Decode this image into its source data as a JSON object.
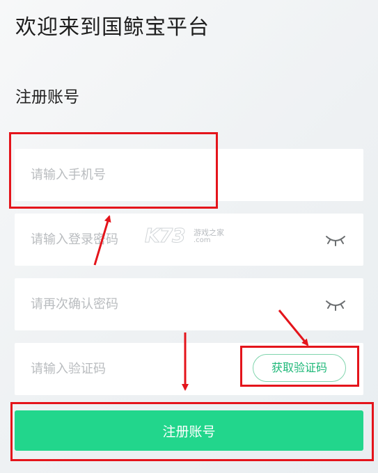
{
  "header": {
    "welcome": "欢迎来到国鲸宝平台",
    "section_title": "注册账号"
  },
  "form": {
    "phone_placeholder": "请输入手机号",
    "password_placeholder": "请输入登录密码",
    "confirm_placeholder": "请再次确认密码",
    "code_placeholder": "请输入验证码",
    "get_code_label": "获取验证码",
    "submit_label": "注册账号",
    "eye_icon": "eye-closed-icon"
  },
  "watermark": {
    "logo": "K73",
    "text": "游戏之家",
    "sub": ".com"
  },
  "colors": {
    "accent": "#22d68c",
    "code_text": "#1fb879",
    "annotation": "#e4141b"
  }
}
